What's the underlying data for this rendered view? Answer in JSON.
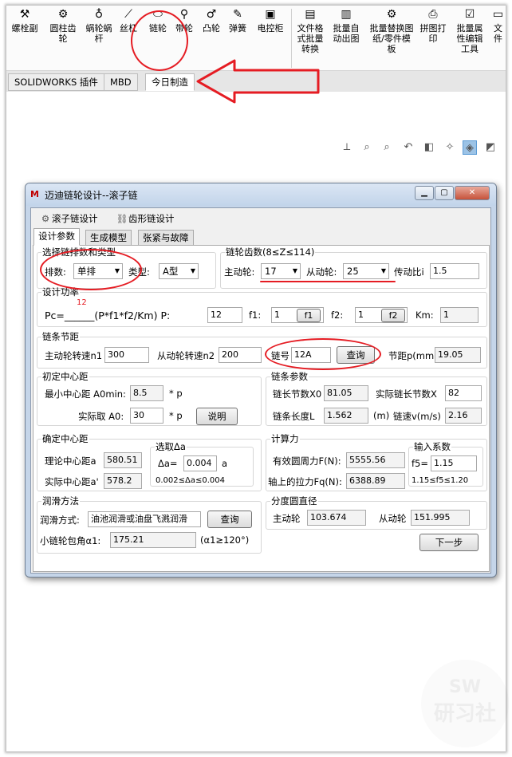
{
  "ribbon": {
    "items": [
      {
        "label": "螺栓副",
        "icon": "bolt-icon",
        "glyph": "⚒"
      },
      {
        "label": "圆柱齿轮",
        "icon": "gear-icon",
        "glyph": "⚙"
      },
      {
        "label": "蜗轮蜗杆",
        "icon": "worm-gear-icon",
        "glyph": "♁"
      },
      {
        "label": "丝杠",
        "icon": "lead-screw-icon",
        "glyph": "⟋"
      },
      {
        "label": "链轮",
        "icon": "sprocket-icon",
        "glyph": "⬭"
      },
      {
        "label": "带轮",
        "icon": "pulley-icon",
        "glyph": "⚲"
      },
      {
        "label": "凸轮",
        "icon": "cam-icon",
        "glyph": "♂"
      },
      {
        "label": "弹簧",
        "icon": "spring-icon",
        "glyph": "✎"
      },
      {
        "label": "电控柜",
        "icon": "cabinet-icon",
        "glyph": "▣"
      },
      {
        "label": "文件格式批量转换",
        "icon": "file-convert-icon",
        "glyph": "▤"
      },
      {
        "label": "批量自动出图",
        "icon": "batch-drawing-icon",
        "glyph": "▥"
      },
      {
        "label": "批量替换图纸/零件模板",
        "icon": "replace-template-icon",
        "glyph": "⚙"
      },
      {
        "label": "拼图打印",
        "icon": "print-icon",
        "glyph": "⎙"
      },
      {
        "label": "批量属性编辑工具",
        "icon": "property-edit-icon",
        "glyph": "☑"
      },
      {
        "label": "文件",
        "icon": "file-icon",
        "glyph": "▭"
      }
    ]
  },
  "command_tabs": [
    "SOLIDWORKS 插件",
    "MBD",
    "今日制造"
  ],
  "dialog": {
    "title": "迈迪链轮设计--滚子链",
    "toolbar": [
      "滚子链设计",
      "齿形链设计"
    ],
    "tabs": [
      "设计参数",
      "生成模型",
      "张紧与故障"
    ],
    "g1": {
      "legend": "选择链排数和类型",
      "rows_label": "排数:",
      "rows_value": "单排",
      "type_label": "类型:",
      "type_value": "A型"
    },
    "g2": {
      "legend": "链轮齿数(8≤Z≤114)",
      "drive_label": "主动轮:",
      "drive_value": "17",
      "driven_label": "从动轮:",
      "driven_value": "25",
      "ratio_label": "传动比i",
      "ratio_value": "1.5"
    },
    "g3": {
      "legend": "设计功率",
      "superscript": "12",
      "formula": "Pc=______(P*f1*f2/Km) P:",
      "p_value": "12",
      "f1_label": "f1:",
      "f1_value": "1",
      "f1_btn": "f1",
      "f2_label": "f2:",
      "f2_value": "1",
      "f2_btn": "f2",
      "km_label": "Km:",
      "km_value": "1"
    },
    "g4": {
      "legend": "链条节距",
      "n1_label": "主动轮转速n1",
      "n1_value": "300",
      "n2_label": "从动轮转速n2",
      "n2_value": "200",
      "chain_label": "链号",
      "chain_value": "12A",
      "query_btn": "查询",
      "pitch_label": "节距p(mm)",
      "pitch_value": "19.05"
    },
    "g5": {
      "legend": "初定中心距",
      "min_label": "最小中心距 A0min:",
      "min_value": "8.5",
      "min_unit": "* p",
      "actual_label": "实际取 A0:",
      "actual_value": "30",
      "actual_unit": "* p",
      "explain_btn": "说明"
    },
    "g6": {
      "legend": "链条参数",
      "links_label": "链长节数X0",
      "links_value": "81.05",
      "actual_links_label": "实际链长节数X",
      "actual_links_value": "82",
      "length_label": "链条长度L",
      "length_value": "1.562",
      "length_unit": "(m)",
      "speed_label": "链速v(m/s)",
      "speed_value": "2.16"
    },
    "g7": {
      "legend": "确定中心距",
      "theory_label": "理论中心距a",
      "theory_value": "580.51",
      "real_label": "实际中心距a'",
      "real_value": "578.2",
      "delta_legend": "选取Δa",
      "delta_label": "Δa=",
      "delta_value": "0.004",
      "delta_unit": "a",
      "delta_range": "0.002≤Δa≤0.004"
    },
    "g8": {
      "legend": "计算力",
      "eff_label": "有效圆周力F(N):",
      "eff_value": "5555.56",
      "axle_label": "轴上的拉力Fq(N):",
      "axle_value": "6388.89",
      "input_legend": "输入系数",
      "f5_label": "f5=",
      "f5_value": "1.15",
      "f5_range": "1.15≤f5≤1.20"
    },
    "g9": {
      "legend": "润滑方法",
      "method_label": "润滑方式:",
      "method_value": "油池润滑或油盘飞溅润滑",
      "query_btn": "查询",
      "angle_label": "小链轮包角α1:",
      "angle_value": "175.21",
      "angle_range": "(α1≥120°)"
    },
    "g10": {
      "legend": "分度圆直径",
      "drive_label": "主动轮",
      "drive_value": "103.674",
      "driven_label": "从动轮",
      "driven_value": "151.995"
    },
    "next_btn": "下一步"
  },
  "watermark": {
    "top": "SW",
    "bottom": "研习社"
  },
  "annotation_color": "#e51c23"
}
